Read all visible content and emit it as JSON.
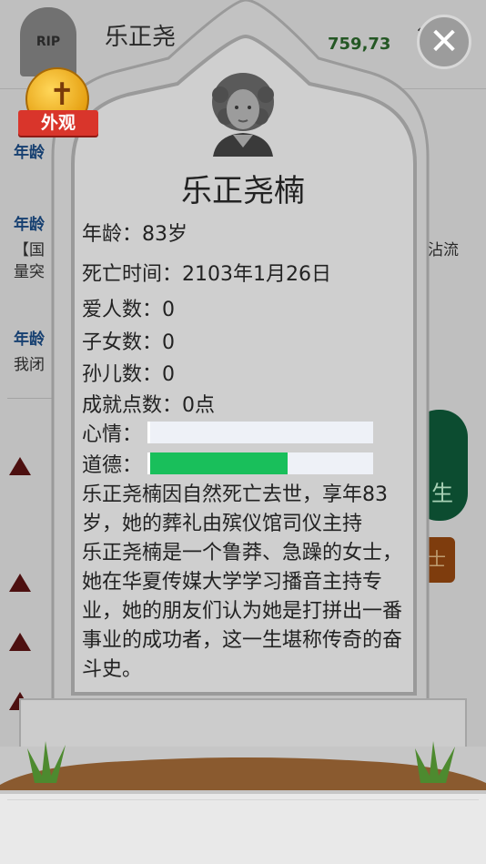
{
  "background": {
    "rip_label": "RIP",
    "name_partial": "乐正尧",
    "money_partial": "759,73",
    "close_partial": "×",
    "age_label": "年龄",
    "line_1": "【国",
    "line_1_right": "沾流",
    "line_2": "量突",
    "line_3": "我闭",
    "green_button_partial": "生",
    "orange_button_partial": "士"
  },
  "overlay": {
    "close_label": "✕",
    "appearance_badge_label": "外观"
  },
  "person": {
    "name": "乐正尧楠",
    "age": "年龄：83岁",
    "death_time": "死亡时间：2103年1月26日",
    "lovers": "爱人数：0",
    "children": "子女数：0",
    "grandchildren": "孙儿数：0",
    "achievements": "成就点数：0点",
    "mood_label": "心情：",
    "morality_label": "道德：",
    "mood_level": 0.0,
    "morality_level": 0.61,
    "death_text": "乐正尧楠因自然死亡去世，享年83岁，她的葬礼由殡仪馆司仪主持",
    "bio_text": "乐正尧楠是一个鲁莽、急躁的女士，她在华夏传媒大学学习播音主持专业，她的朋友们认为她是打拼出一番事业的成功者，这一生堪称传奇的奋斗史。"
  },
  "colors": {
    "morality_fill": "#19bf5b",
    "stone": "#c4c4c4",
    "badge_ribbon": "#d9352b"
  }
}
